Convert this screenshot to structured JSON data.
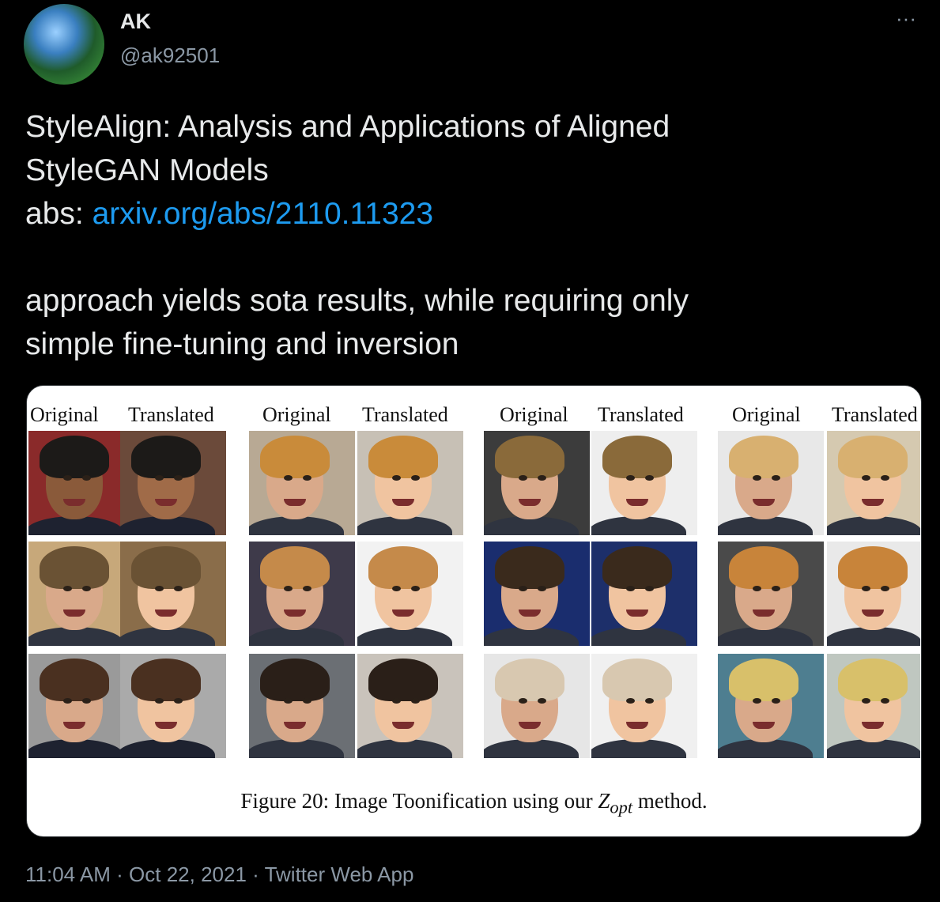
{
  "author": {
    "name": "AK",
    "handle": "@ak92501",
    "avatar_icon": "avatar-landscape-photo"
  },
  "tweet": {
    "line1": "StyleAlign: Analysis and Applications of Aligned",
    "line2": "StyleGAN Models",
    "abs_prefix": "abs: ",
    "abs_link": "arxiv.org/abs/2110.11323",
    "line4": "approach yields sota results, while requiring only",
    "line5": "simple fine-tuning and inversion"
  },
  "media": {
    "headers": [
      "Original",
      "Translated",
      "Original",
      "Translated",
      "Original",
      "Translated",
      "Original",
      "Translated"
    ],
    "caption_prefix": "Figure 20: Image Toonification using our ",
    "caption_math": "Z",
    "caption_sub": "opt",
    "caption_suffix": " method."
  },
  "meta": {
    "time": "11:04 AM",
    "date": "Oct 22, 2021",
    "source": "Twitter Web App",
    "separator": " · "
  },
  "colors": {
    "background": "#000000",
    "text": "#e7e9ea",
    "muted": "#8b98a5",
    "link": "#1d9bf0"
  }
}
